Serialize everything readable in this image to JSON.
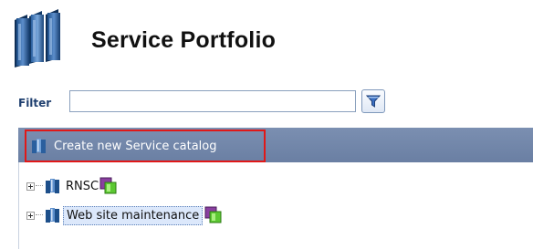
{
  "header": {
    "title": "Service Portfolio",
    "icon": "service-books-icon"
  },
  "filter": {
    "label": "Filter",
    "value": "",
    "button_icon": "funnel-icon"
  },
  "toolbar": {
    "create_label": "Create new Service catalog",
    "create_icon": "service-catalog-icon",
    "background": "#7388ab",
    "highlight_color": "#e01818"
  },
  "tree": {
    "nodes": [
      {
        "label": "RNSC",
        "icon": "service-catalog-icon",
        "status_icon": "green-status-icon",
        "selected": false
      },
      {
        "label": "Web site maintenance",
        "icon": "service-catalog-icon",
        "status_icon": "green-status-icon",
        "selected": true
      }
    ]
  }
}
